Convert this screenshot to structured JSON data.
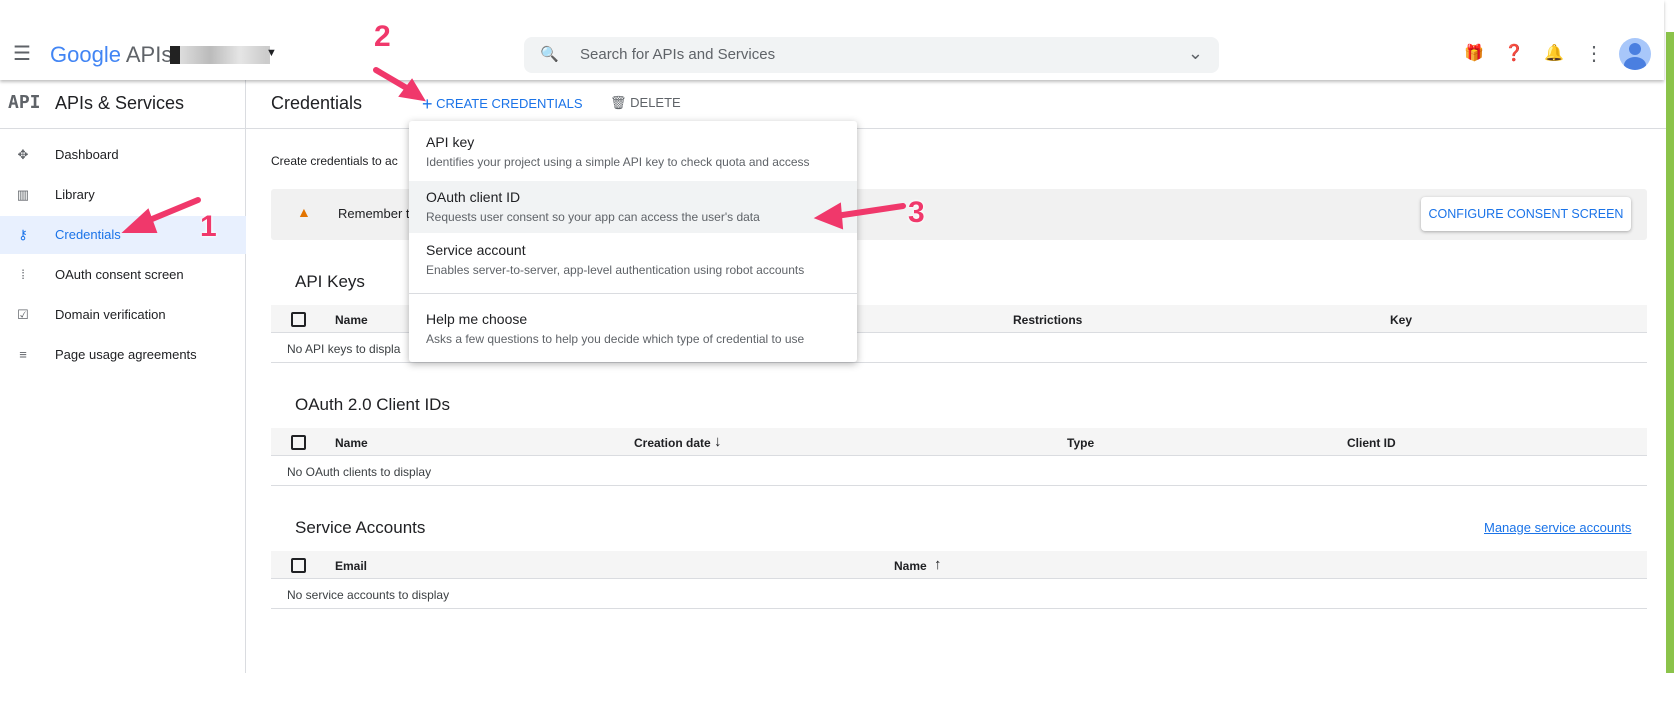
{
  "header": {
    "logo_google": "Google",
    "logo_apis": "APIs",
    "search_placeholder": "Search for APIs and Services"
  },
  "sidebar": {
    "title": "APIs & Services",
    "badge": "API",
    "items": [
      {
        "label": "Dashboard",
        "icon": "dashboard-icon"
      },
      {
        "label": "Library",
        "icon": "library-icon"
      },
      {
        "label": "Credentials",
        "icon": "key-icon",
        "active": true
      },
      {
        "label": "OAuth consent screen",
        "icon": "consent-icon"
      },
      {
        "label": "Domain verification",
        "icon": "checkbox-icon"
      },
      {
        "label": "Page usage agreements",
        "icon": "settings-list-icon"
      }
    ]
  },
  "toolbar": {
    "title": "Credentials",
    "create_label": "CREATE CREDENTIALS",
    "delete_label": "DELETE"
  },
  "main": {
    "intro": "Create credentials to ac",
    "banner_text": "Remember t",
    "configure_button": "CONFIGURE CONSENT SCREEN",
    "api_keys": {
      "title": "API Keys",
      "columns": [
        "Name",
        "Restrictions",
        "Key"
      ],
      "empty": "No API keys to displa"
    },
    "oauth": {
      "title": "OAuth 2.0 Client IDs",
      "columns": [
        "Name",
        "Creation date",
        "Type",
        "Client ID"
      ],
      "empty": "No OAuth clients to display"
    },
    "service": {
      "title": "Service Accounts",
      "manage_link": "Manage service accounts",
      "columns": [
        "Email",
        "Name"
      ],
      "empty": "No service accounts to display"
    }
  },
  "menu": {
    "items": [
      {
        "title": "API key",
        "desc": "Identifies your project using a simple API key to check quota and access"
      },
      {
        "title": "OAuth client ID",
        "desc": "Requests user consent so your app can access the user's data"
      },
      {
        "title": "Service account",
        "desc": "Enables server-to-server, app-level authentication using robot accounts"
      },
      {
        "title": "Help me choose",
        "desc": "Asks a few questions to help you decide which type of credential to use"
      }
    ]
  },
  "annotations": {
    "one": "1",
    "two": "2",
    "three": "3"
  },
  "colors": {
    "accent": "#1a73e8",
    "annotation": "#f0386b",
    "warning": "#e37400",
    "scrollbar": "#8bc34a"
  }
}
